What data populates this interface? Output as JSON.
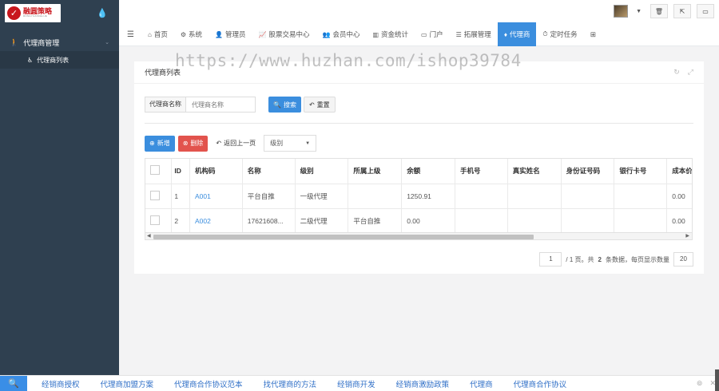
{
  "logo": {
    "name": "融圆策略",
    "sub": "RONGYUANCELUE"
  },
  "sidebar": {
    "group_label": "代理商管理",
    "sub_label": "代理商列表"
  },
  "tabs": [
    {
      "icon": "⌂",
      "label": "首页"
    },
    {
      "icon": "⚙",
      "label": "系统"
    },
    {
      "icon": "👤",
      "label": "管理员"
    },
    {
      "icon": "📈",
      "label": "股票交易中心"
    },
    {
      "icon": "👥",
      "label": "会员中心"
    },
    {
      "icon": "▥",
      "label": "资金统计"
    },
    {
      "icon": "▭",
      "label": "门户"
    },
    {
      "icon": "☰",
      "label": "拓展管理"
    },
    {
      "icon": "♦",
      "label": "代理商"
    },
    {
      "icon": "⏱",
      "label": "定时任务"
    }
  ],
  "panel": {
    "title": "代理商列表"
  },
  "search": {
    "label": "代理商名称",
    "placeholder": "代理商名称",
    "search_btn": "搜索",
    "reset_btn": "重置"
  },
  "actions": {
    "add": "新增",
    "delete": "删除",
    "back": "返回上一页",
    "level_select": "级别"
  },
  "table": {
    "columns": [
      "ID",
      "机构码",
      "名称",
      "级别",
      "所属上级",
      "余额",
      "手机号",
      "真实姓名",
      "身份证号码",
      "银行卡号",
      "成本价"
    ],
    "rows": [
      [
        "1",
        "A001",
        "平台自推",
        "一级代理",
        "",
        "1250.91",
        "",
        "",
        "",
        "",
        "0.00"
      ],
      [
        "2",
        "A002",
        "17621608...",
        "二级代理",
        "平台自推",
        "0.00",
        "",
        "",
        "",
        "",
        "0.00"
      ]
    ]
  },
  "pager": {
    "page": "1",
    "info_prefix": "/ 1 页。共",
    "total": "2",
    "info_suffix": "条数据，每页显示数量",
    "size": "20"
  },
  "watermark": "https://www.huzhan.com/ishop39784",
  "bottom_links": [
    "经销商授权",
    "代理商加盟方案",
    "代理商合作协议范本",
    "找代理商的方法",
    "经销商开发",
    "经销商激励政策",
    "代理商",
    "代理商合作协议"
  ],
  "colors": {
    "accent": "#3b8ede",
    "sidebar": "#2f4050",
    "danger": "#e2534d"
  }
}
